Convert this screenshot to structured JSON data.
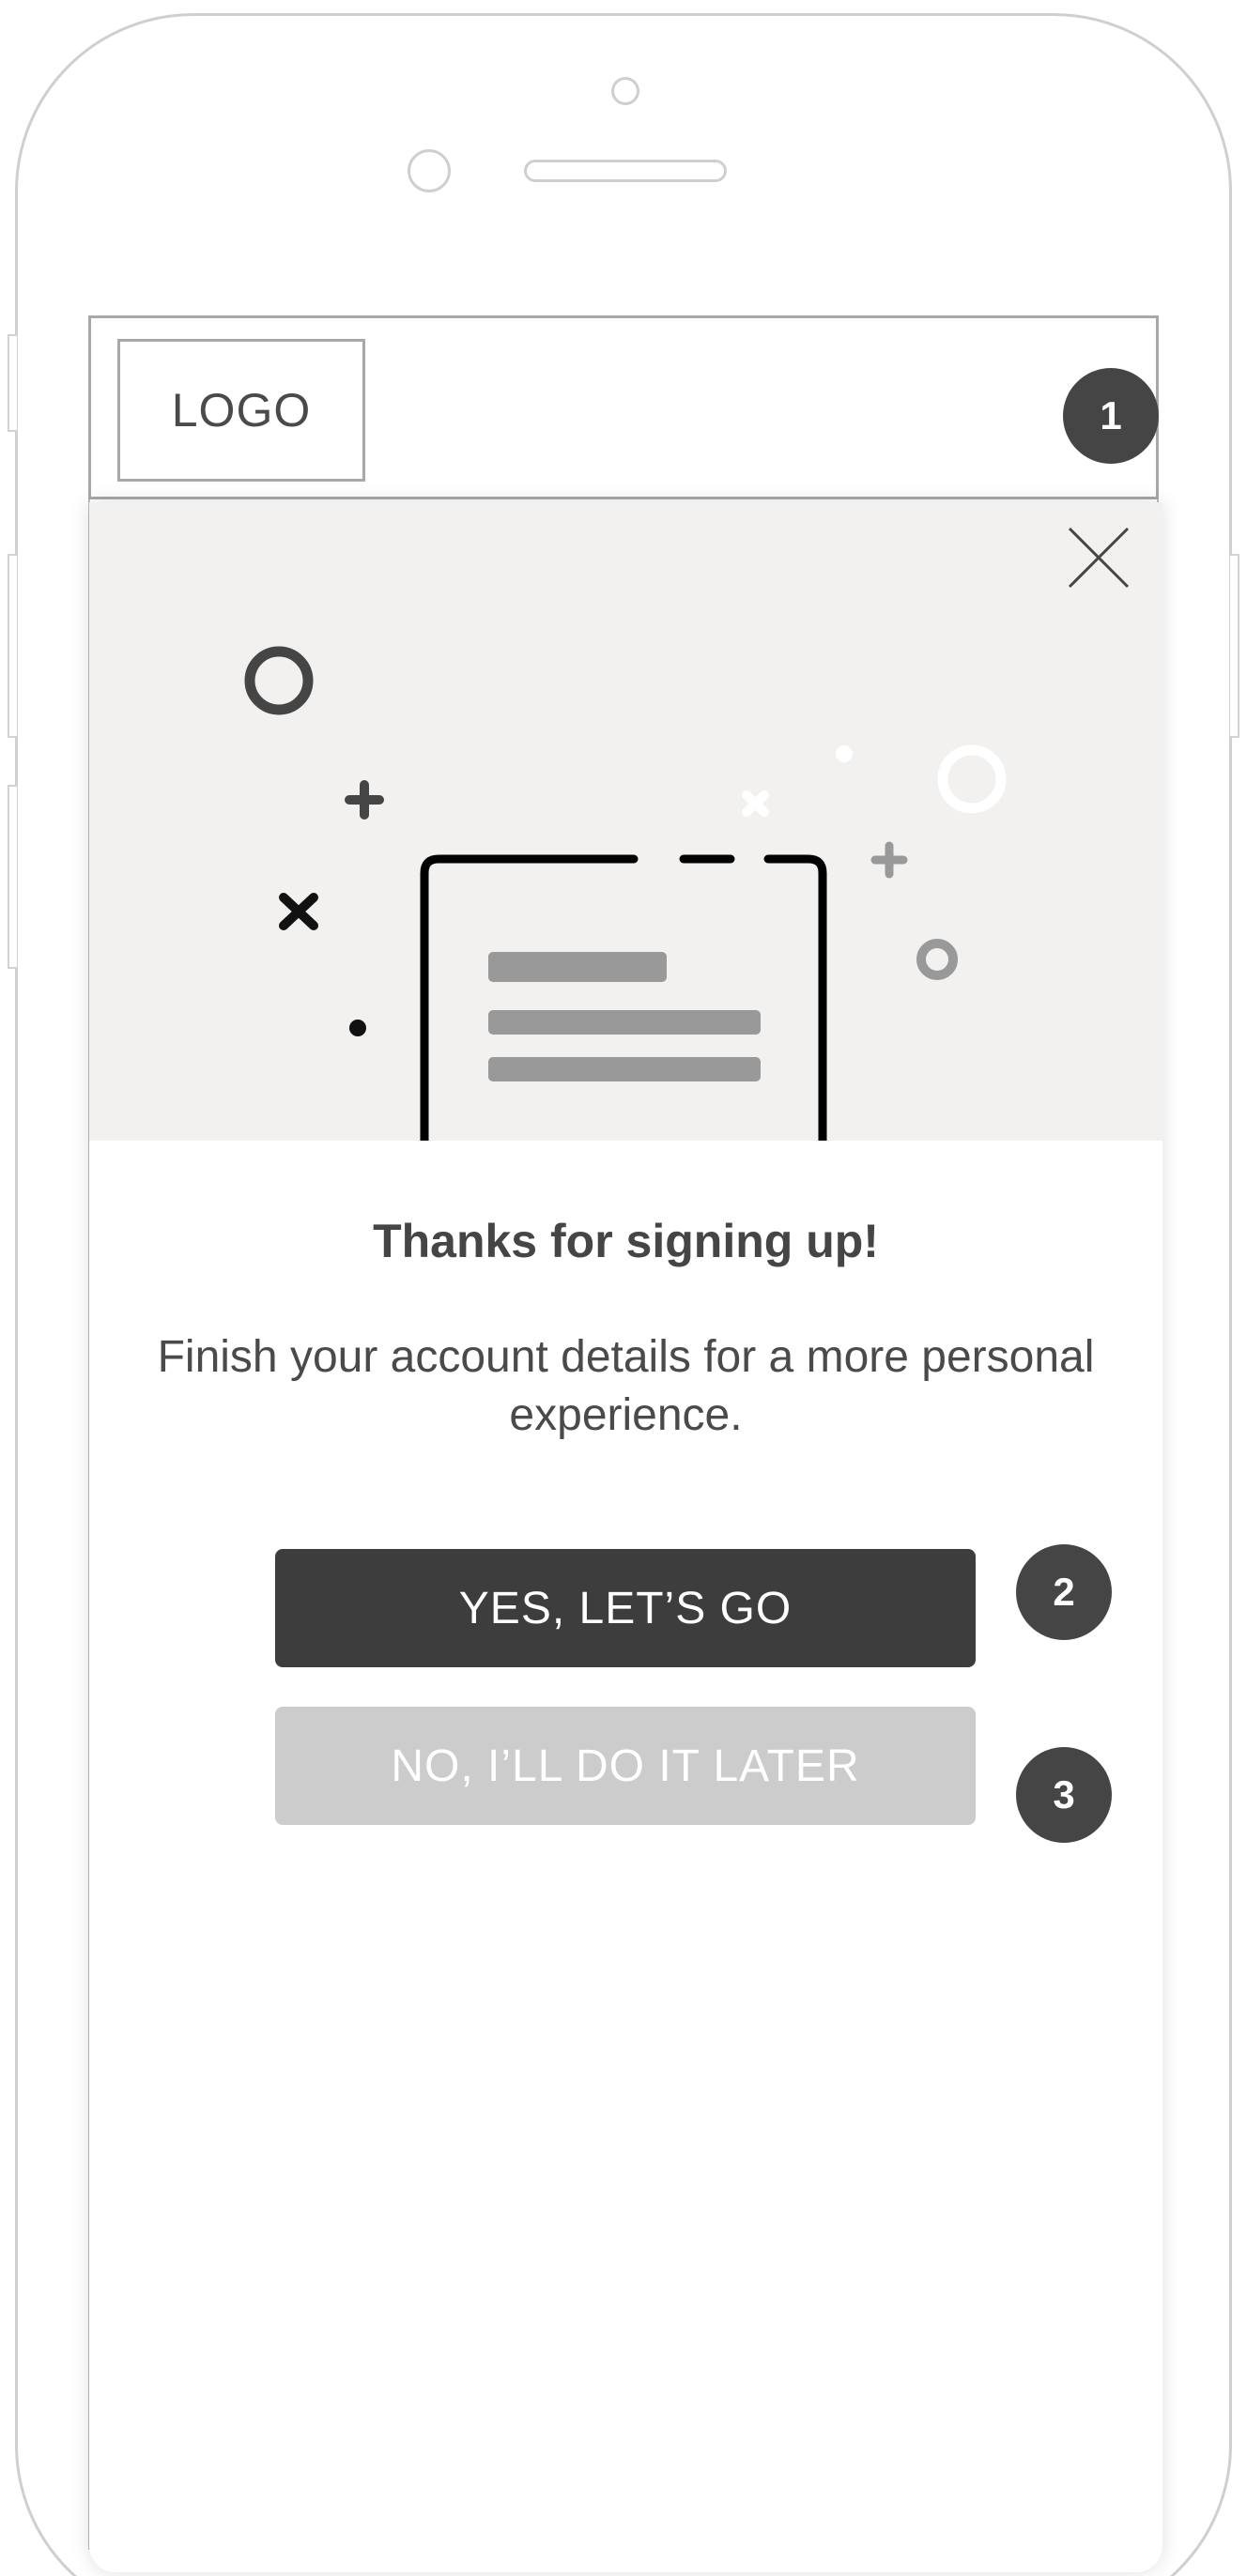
{
  "header": {
    "logo_text": "LOGO"
  },
  "annotations": {
    "badge_1": "1",
    "badge_2": "2",
    "badge_3": "3"
  },
  "modal": {
    "illustration": "document-with-confetti",
    "close_icon": "close-icon",
    "title": "Thanks for signing up!",
    "message": "Finish your account details for a more personal experience.",
    "primary_button": "YES, LET’S GO",
    "secondary_button": "NO, I’LL DO IT LATER"
  },
  "colors": {
    "primary_button_bg": "#3d3d3d",
    "secondary_button_bg": "#cccccc",
    "badge_bg": "#454545",
    "illustration_bg": "#f2f1ef",
    "text": "#4a4a4a"
  }
}
